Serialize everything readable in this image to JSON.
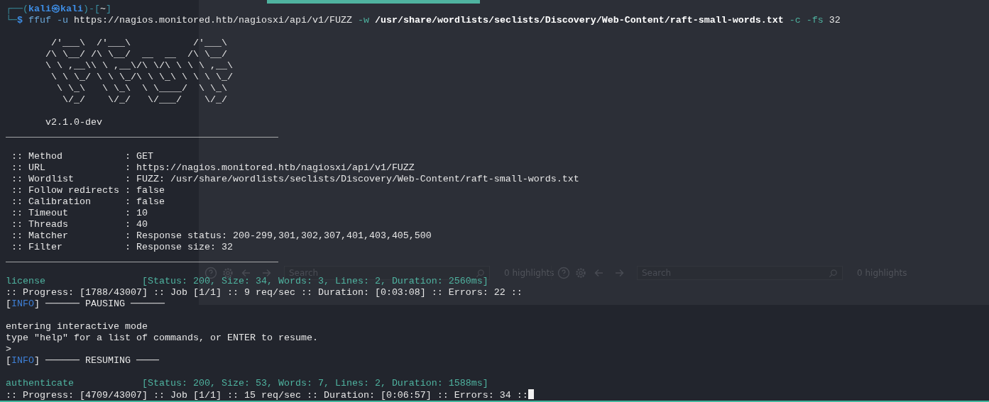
{
  "background_window": {
    "selection_visible": true,
    "search_bars": [
      {
        "placeholder": "Search",
        "highlights": "0 highlights"
      },
      {
        "placeholder": "Search",
        "highlights": "0 highlights"
      }
    ]
  },
  "terminal": {
    "cursor": true,
    "blocks": [
      {
        "lines": [
          {
            "spans": [
              {
                "kind": "frame",
                "text": "┌──("
              },
              {
                "kind": "user",
                "text": "kali㉿kali"
              },
              {
                "kind": "frame",
                "text": ")-["
              },
              {
                "kind": "plain",
                "text": "~"
              },
              {
                "kind": "frame",
                "text": "]"
              }
            ]
          },
          {
            "spans": [
              {
                "kind": "frame",
                "text": "└─"
              },
              {
                "kind": "user",
                "text": "$ "
              },
              {
                "kind": "command",
                "text": "ffuf -u"
              },
              {
                "kind": "plain",
                "text": " https://nagios.monitored.htb/nagiosxi/api/v1/FUZZ "
              },
              {
                "kind": "flag",
                "text": "-w "
              },
              {
                "kind": "path",
                "text": "/usr/share/wordlists/seclists/Discovery/Web-Content/raft-small-words.txt"
              },
              {
                "kind": "flag",
                "text": " -c -fs"
              },
              {
                "kind": "plain",
                "text": " 32"
              }
            ]
          }
        ]
      },
      {
        "lines": [
          {
            "spans": [
              {
                "kind": "plain",
                "text": "        /'___\\  /'___\\           /'___\\"
              }
            ]
          },
          {
            "spans": [
              {
                "kind": "plain",
                "text": "       /\\ \\__/ /\\ \\__/  __  __  /\\ \\__/"
              }
            ]
          },
          {
            "spans": [
              {
                "kind": "plain",
                "text": "       \\ \\ ,__\\\\ \\ ,__\\/\\ \\/\\ \\ \\ \\ ,__\\"
              }
            ]
          },
          {
            "spans": [
              {
                "kind": "plain",
                "text": "        \\ \\ \\_/ \\ \\ \\_/\\ \\ \\_\\ \\ \\ \\ \\_/"
              }
            ]
          },
          {
            "spans": [
              {
                "kind": "plain",
                "text": "         \\ \\_\\   \\ \\_\\  \\ \\____/  \\ \\_\\"
              }
            ]
          },
          {
            "spans": [
              {
                "kind": "plain",
                "text": "          \\/_/    \\/_/   \\/___/    \\/_/"
              }
            ]
          }
        ]
      },
      {
        "lines": [
          {
            "spans": [
              {
                "kind": "plain",
                "text": "       v2.1.0-dev"
              }
            ]
          },
          {
            "spans": [
              {
                "kind": "plain",
                "text": "________________________________________________"
              }
            ]
          }
        ]
      },
      {
        "lines": [
          {
            "spans": [
              {
                "kind": "plain",
                "text": " :: Method           : GET"
              }
            ]
          },
          {
            "spans": [
              {
                "kind": "plain",
                "text": " :: URL              : https://nagios.monitored.htb/nagiosxi/api/v1/FUZZ"
              }
            ]
          },
          {
            "spans": [
              {
                "kind": "plain",
                "text": " :: Wordlist         : FUZZ: /usr/share/wordlists/seclists/Discovery/Web-Content/raft-small-words.txt"
              }
            ]
          },
          {
            "spans": [
              {
                "kind": "plain",
                "text": " :: Follow redirects : false"
              }
            ]
          },
          {
            "spans": [
              {
                "kind": "plain",
                "text": " :: Calibration      : false"
              }
            ]
          },
          {
            "spans": [
              {
                "kind": "plain",
                "text": " :: Timeout          : 10"
              }
            ]
          },
          {
            "spans": [
              {
                "kind": "plain",
                "text": " :: Threads          : 40"
              }
            ]
          },
          {
            "spans": [
              {
                "kind": "plain",
                "text": " :: Matcher          : Response status: 200-299,301,302,307,401,403,405,500"
              }
            ]
          },
          {
            "spans": [
              {
                "kind": "plain",
                "text": " :: Filter           : Response size: 32"
              }
            ]
          },
          {
            "spans": [
              {
                "kind": "plain",
                "text": "________________________________________________"
              }
            ]
          }
        ]
      },
      {
        "lines": [
          {
            "spans": [
              {
                "kind": "status",
                "text": "license                 [Status: 200, Size: 34, Words: 3, Lines: 2, Duration: 2560ms]"
              }
            ]
          },
          {
            "spans": [
              {
                "kind": "plain",
                "text": ":: Progress: [1788/43007] :: Job [1/1] :: 9 req/sec :: Duration: [0:03:08] :: Errors: 22 ::"
              }
            ]
          },
          {
            "spans": [
              {
                "kind": "plain",
                "text": "["
              },
              {
                "kind": "info",
                "text": "INFO"
              },
              {
                "kind": "plain",
                "text": "] ────── PAUSING ──────"
              }
            ]
          }
        ]
      },
      {
        "lines": [
          {
            "spans": [
              {
                "kind": "plain",
                "text": "entering interactive mode"
              }
            ]
          },
          {
            "spans": [
              {
                "kind": "plain",
                "text": "type \"help\" for a list of commands, or ENTER to resume."
              }
            ]
          },
          {
            "spans": [
              {
                "kind": "plain",
                "text": ">"
              }
            ]
          },
          {
            "spans": [
              {
                "kind": "plain",
                "text": "["
              },
              {
                "kind": "info",
                "text": "INFO"
              },
              {
                "kind": "plain",
                "text": "] ────── RESUMING ────"
              }
            ]
          }
        ]
      },
      {
        "lines": [
          {
            "spans": [
              {
                "kind": "status",
                "text": "authenticate            [Status: 200, Size: 53, Words: 7, Lines: 2, Duration: 1588ms]"
              }
            ]
          },
          {
            "spans": [
              {
                "kind": "plain",
                "text": ":: Progress: [4709/43007] :: Job [1/1] :: 15 req/sec :: Duration: [0:06:57] :: Errors: 34 ::"
              }
            ]
          }
        ]
      }
    ]
  }
}
